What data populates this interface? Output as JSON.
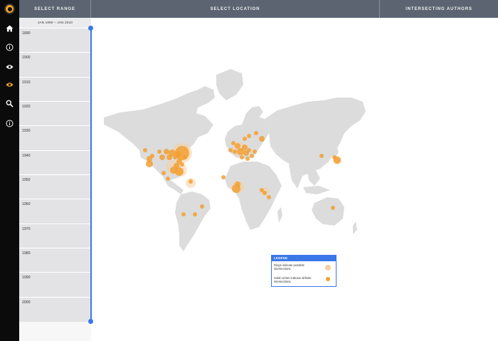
{
  "header": {
    "select_range": "SELECT RANGE",
    "select_location": "SELECT LOCATION",
    "intersecting_authors": "INTERSECTING AUTHORS"
  },
  "rail": {
    "icons": [
      "logo-icon",
      "home-icon",
      "info-icon",
      "eye-icon",
      "eye-active-icon",
      "search-icon",
      "info-icon"
    ],
    "active_color": "#f6a623"
  },
  "timeline": {
    "range_label": "JAN 1890 – JAN 2010",
    "ticks": [
      "1890",
      "1900",
      "1910",
      "1920",
      "1930",
      "1940",
      "1950",
      "1960",
      "1970",
      "1980",
      "1990",
      "2000"
    ],
    "accent": "#3a77e8"
  },
  "legend": {
    "title": "LEGEND",
    "rings_text": "Rings indicate possible intersections.",
    "solid_text": "Solid circles indicate definite intersections."
  },
  "colors": {
    "header_bg": "#5b6470",
    "rail_bg": "#0b0b0b",
    "land": "#dcdcdc",
    "marker": "#f2a033",
    "ring": "#f7cfa0"
  }
}
